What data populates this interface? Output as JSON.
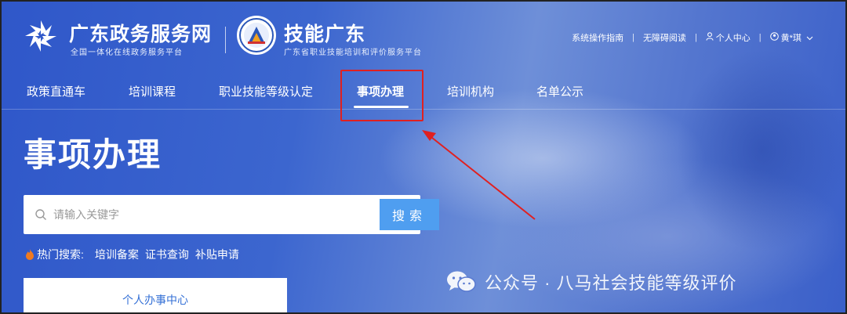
{
  "header": {
    "brand1": {
      "title": "广东政务服务网",
      "subtitle": "全国一体化在线政务服务平台"
    },
    "brand2": {
      "title": "技能广东",
      "subtitle": "广东省职业技能培训和评价服务平台"
    },
    "links": {
      "guide": "系统操作指南",
      "accessibility": "无障碍阅读",
      "personal_center": "个人中心",
      "user": "黄*琪"
    }
  },
  "nav": {
    "items": [
      {
        "label": "政策直通车"
      },
      {
        "label": "培训课程"
      },
      {
        "label": "职业技能等级认定"
      },
      {
        "label": "事项办理"
      },
      {
        "label": "培训机构"
      },
      {
        "label": "名单公示"
      }
    ],
    "active_index": 3
  },
  "hero": {
    "title": "事项办理",
    "search": {
      "placeholder": "请输入关键字",
      "button_label": "搜索"
    },
    "hot_search": {
      "label": "热门搜索:",
      "items": [
        "培训备案",
        "证书查询",
        "补贴申请"
      ]
    },
    "card": {
      "label": "个人办事中心"
    }
  },
  "watermark": {
    "text": "公众号 · 八马社会技能等级评价"
  },
  "colors": {
    "background": "#3c66cf",
    "search_button": "#4f9ef0",
    "highlight": "#e02020",
    "card_text": "#3470d6"
  }
}
